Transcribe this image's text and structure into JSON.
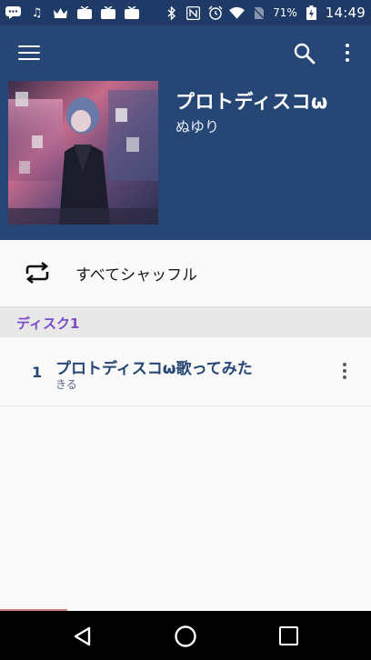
{
  "status_bar": {
    "battery_percent": "71%",
    "time": "14:49",
    "left_icons": [
      "chat-icon",
      "music-note-icon",
      "crown-icon",
      "tv-icon",
      "tv-icon",
      "tv-icon"
    ],
    "right_icons": [
      "bluetooth-icon",
      "nfc-icon",
      "alarm-icon",
      "wifi-icon",
      "no-sim-icon",
      "battery-charging-icon"
    ]
  },
  "album": {
    "title": "プロトディスコω",
    "artist": "ぬゆり"
  },
  "shuffle": {
    "label": "すべてシャッフル"
  },
  "disc": {
    "label": "ディスク1"
  },
  "tracks": [
    {
      "number": "1",
      "title": "プロトディスコω歌ってみた",
      "artist": "きる"
    }
  ],
  "colors": {
    "status_bar": "#1f3a66",
    "header": "#264675",
    "disc_label": "#7a4bc9",
    "track_text": "#264675"
  }
}
